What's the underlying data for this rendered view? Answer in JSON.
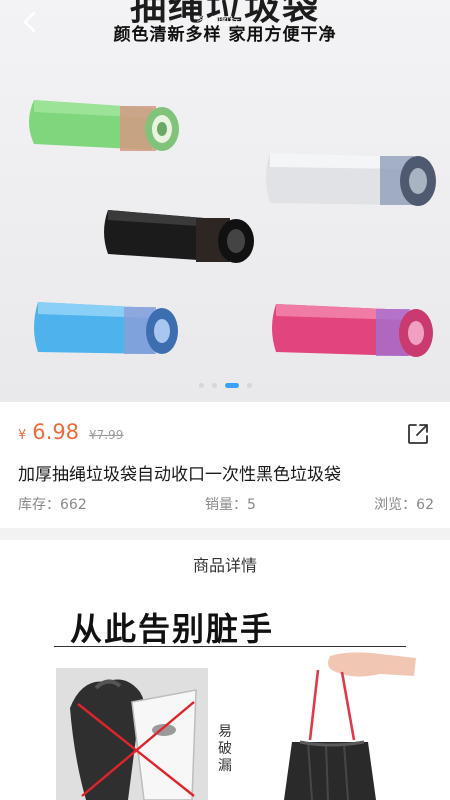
{
  "hero": {
    "title": "抽绳垃圾袋",
    "subtitle": "颜色清新多样  家用方便干净",
    "watermark": "多多图标",
    "carousel": {
      "count": 4,
      "active_index": 2
    }
  },
  "product": {
    "currency": "¥",
    "price": "6.98",
    "original_price": "¥7.99",
    "title": "加厚抽绳垃圾袋自动收口一次性黑色垃圾袋",
    "stock_label": "库存：662",
    "sales_label": "销量：5",
    "views_label": "浏览：62"
  },
  "detail": {
    "header": "商品详情",
    "poster_title": "从此告别脏手",
    "poster_note": "易破漏"
  },
  "colors": {
    "accent": "#f06a3b",
    "indicator": "#3aa0ff",
    "rolls": [
      "#7ed67a",
      "#dcdfe4",
      "#1c1c1c",
      "#4fb1ea",
      "#e0407a"
    ]
  }
}
